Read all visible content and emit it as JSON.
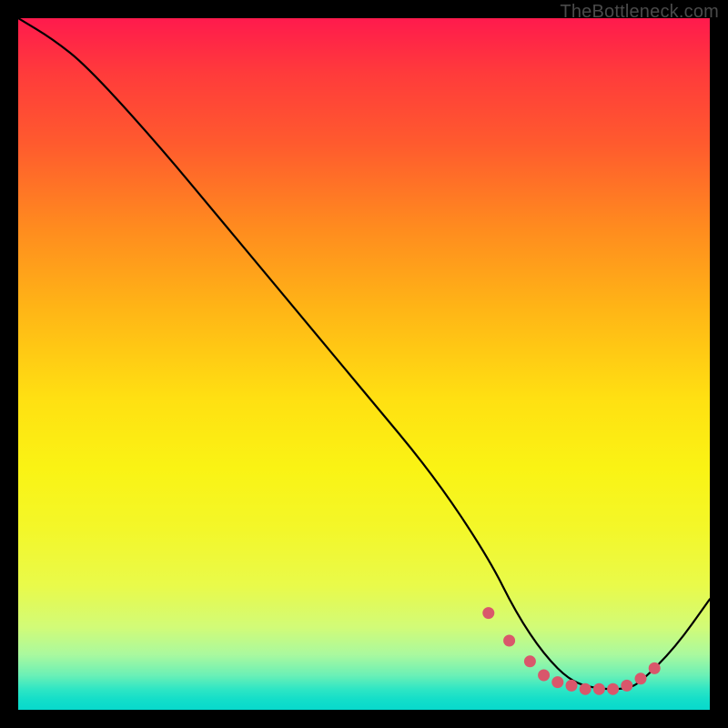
{
  "attribution": "TheBottleneck.com",
  "chart_data": {
    "type": "line",
    "title": "",
    "xlabel": "",
    "ylabel": "",
    "xlim": [
      0,
      100
    ],
    "ylim": [
      0,
      100
    ],
    "series": [
      {
        "name": "curve",
        "x": [
          0,
          5,
          10,
          20,
          30,
          40,
          50,
          60,
          68,
          72,
          76,
          80,
          84,
          88,
          90,
          95,
          100
        ],
        "y": [
          100,
          97,
          93,
          82,
          70,
          58,
          46,
          34,
          22,
          14,
          8,
          4,
          3,
          3,
          4,
          9,
          16
        ]
      }
    ],
    "markers": {
      "name": "highlight-dots",
      "color": "#d9576b",
      "x": [
        68,
        71,
        74,
        76,
        78,
        80,
        82,
        84,
        86,
        88,
        90,
        92
      ],
      "y": [
        14,
        10,
        7,
        5,
        4,
        3.5,
        3,
        3,
        3,
        3.5,
        4.5,
        6
      ]
    }
  }
}
